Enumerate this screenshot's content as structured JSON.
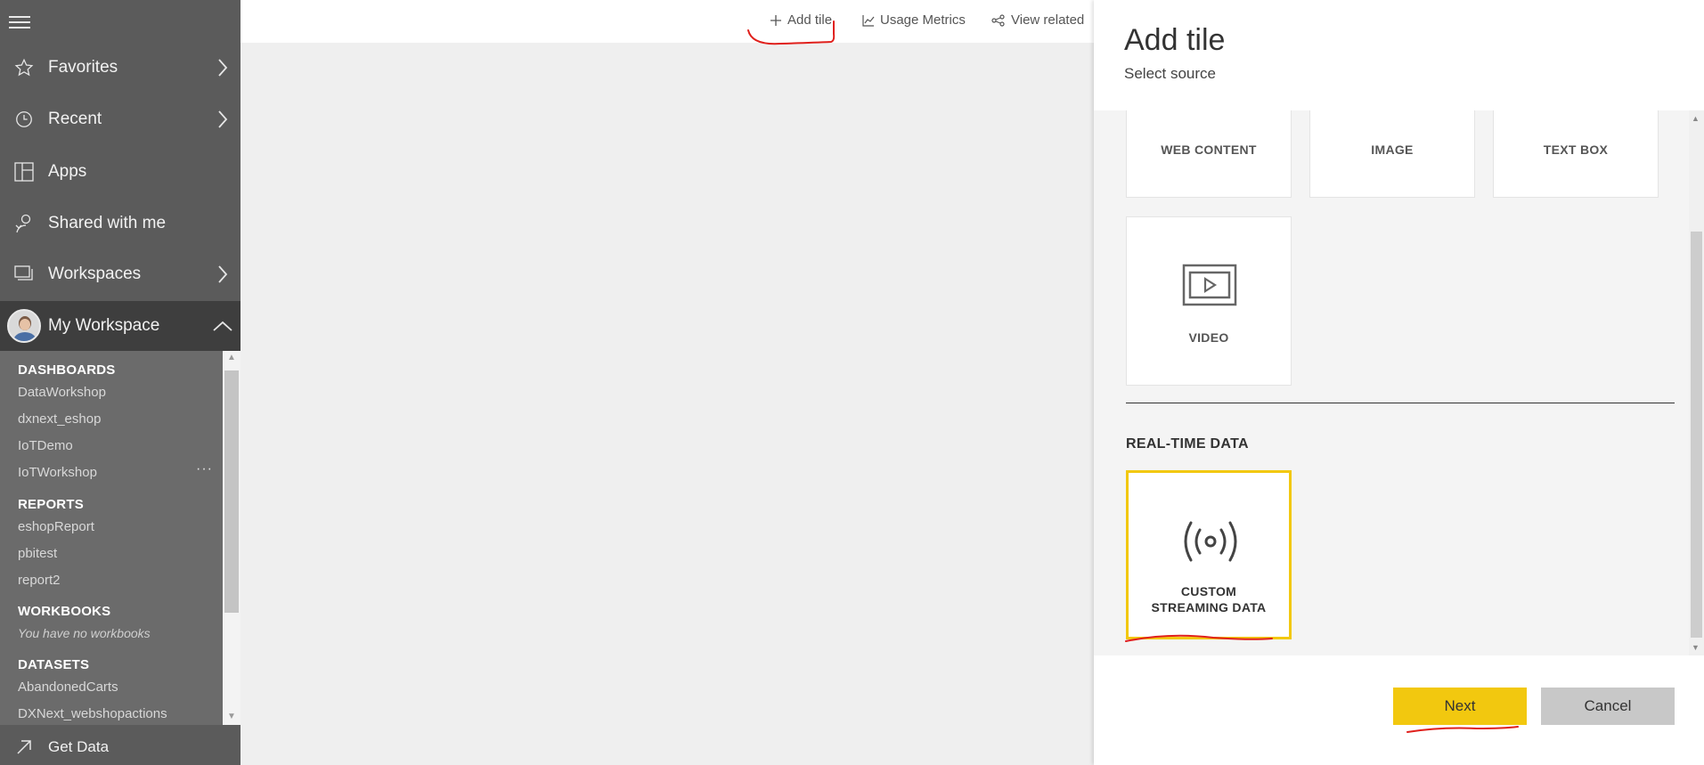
{
  "sidebar": {
    "items": [
      {
        "label": "Favorites",
        "icon": "star-icon"
      },
      {
        "label": "Recent",
        "icon": "clock-icon"
      },
      {
        "label": "Apps",
        "icon": "apps-icon"
      },
      {
        "label": "Shared with me",
        "icon": "person-icon"
      },
      {
        "label": "Workspaces",
        "icon": "workspaces-icon"
      }
    ],
    "my_workspace": {
      "label": "My Workspace"
    },
    "sections": {
      "dashboards": {
        "title": "DASHBOARDS",
        "items": [
          "DataWorkshop",
          "dxnext_eshop",
          "IoTDemo",
          "IoTWorkshop"
        ]
      },
      "reports": {
        "title": "REPORTS",
        "items": [
          "eshopReport",
          "pbitest",
          "report2"
        ]
      },
      "workbooks": {
        "title": "WORKBOOKS",
        "empty": "You have no workbooks"
      },
      "datasets": {
        "title": "DATASETS",
        "items": [
          "AbandonedCarts",
          "DXNext_webshopactions"
        ]
      }
    },
    "more": "···",
    "get_data": "Get Data"
  },
  "topbar": {
    "add_tile": "Add tile",
    "usage_metrics": "Usage Metrics",
    "view_related": "View related"
  },
  "panel": {
    "title": "Add tile",
    "subtitle": "Select source",
    "tiles": [
      "WEB CONTENT",
      "IMAGE",
      "TEXT BOX",
      "VIDEO"
    ],
    "realtime_title": "REAL-TIME DATA",
    "streaming_tile": {
      "line1": "CUSTOM",
      "line2": "STREAMING DATA"
    },
    "next": "Next",
    "cancel": "Cancel"
  },
  "colors": {
    "sidebar": "#5b5b5b",
    "accent": "#f2c80f",
    "annotation": "#e0201c"
  }
}
